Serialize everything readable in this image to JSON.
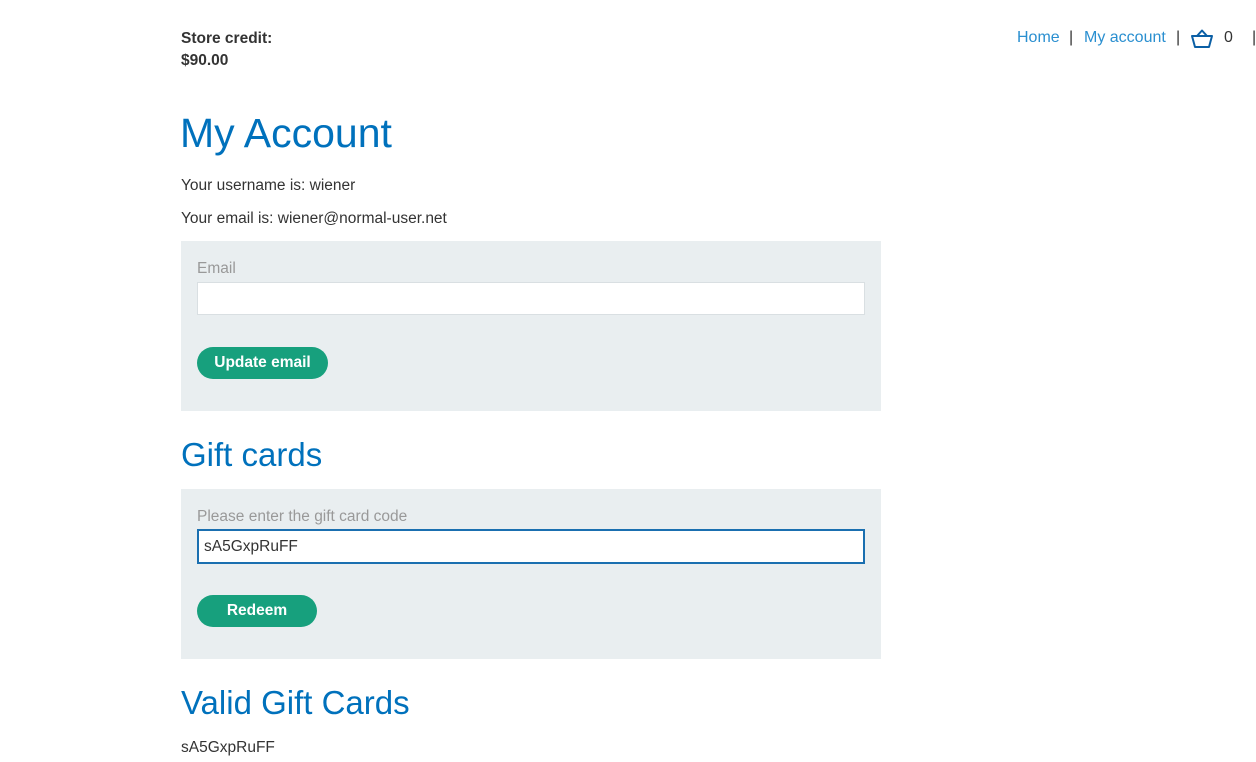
{
  "header": {
    "store_credit_label": "Store credit:",
    "store_credit_value": "$90.00",
    "nav": {
      "home": "Home",
      "my_account": "My account",
      "separator": "|",
      "cart_count": "0"
    }
  },
  "main": {
    "title": "My Account",
    "username_line": "Your username is: wiener",
    "email_line": "Your email is: wiener@normal-user.net",
    "email_form": {
      "label": "Email",
      "value": "",
      "submit_label": "Update email"
    },
    "gift_cards": {
      "title": "Gift cards",
      "label": "Please enter the gift card code",
      "value": "sA5GxpRuFF",
      "submit_label": "Redeem"
    },
    "valid_gift_cards": {
      "title": "Valid Gift Cards",
      "codes": [
        "sA5GxpRuFF"
      ]
    }
  },
  "colors": {
    "heading": "#0071bc",
    "link": "#2a8fd0",
    "button": "#17a07d",
    "panel": "#e9eef0",
    "focus_border": "#1a6fb0"
  },
  "icons": {
    "cart": "shopping-basket-icon"
  }
}
